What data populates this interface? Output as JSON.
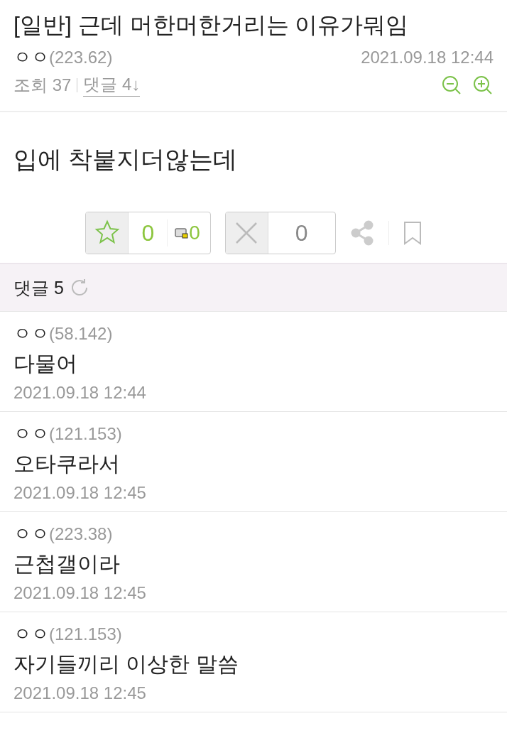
{
  "post": {
    "title": "[일반] 근데 머한머한거리는 이유가뭐임",
    "author": "ㅇㅇ",
    "ip": "(223.62)",
    "date": "2021.09.18 12:44",
    "views_label": "조회 37",
    "comments_link": "댓글 4↓",
    "body": "입에 착붙지더않는데"
  },
  "votes": {
    "up": "0",
    "up_mobile": "0",
    "down": "0"
  },
  "comments_header": {
    "label": "댓글 5"
  },
  "comments": [
    {
      "author": "ㅇㅇ",
      "ip": "(58.142)",
      "text": "다물어",
      "date": "2021.09.18 12:44"
    },
    {
      "author": "ㅇㅇ",
      "ip": "(121.153)",
      "text": "오타쿠라서",
      "date": "2021.09.18 12:45"
    },
    {
      "author": "ㅇㅇ",
      "ip": "(223.38)",
      "text": "근첩갤이라",
      "date": "2021.09.18 12:45"
    },
    {
      "author": "ㅇㅇ",
      "ip": "(121.153)",
      "text": "자기들끼리 이상한 말씀",
      "date": "2021.09.18 12:45"
    }
  ]
}
